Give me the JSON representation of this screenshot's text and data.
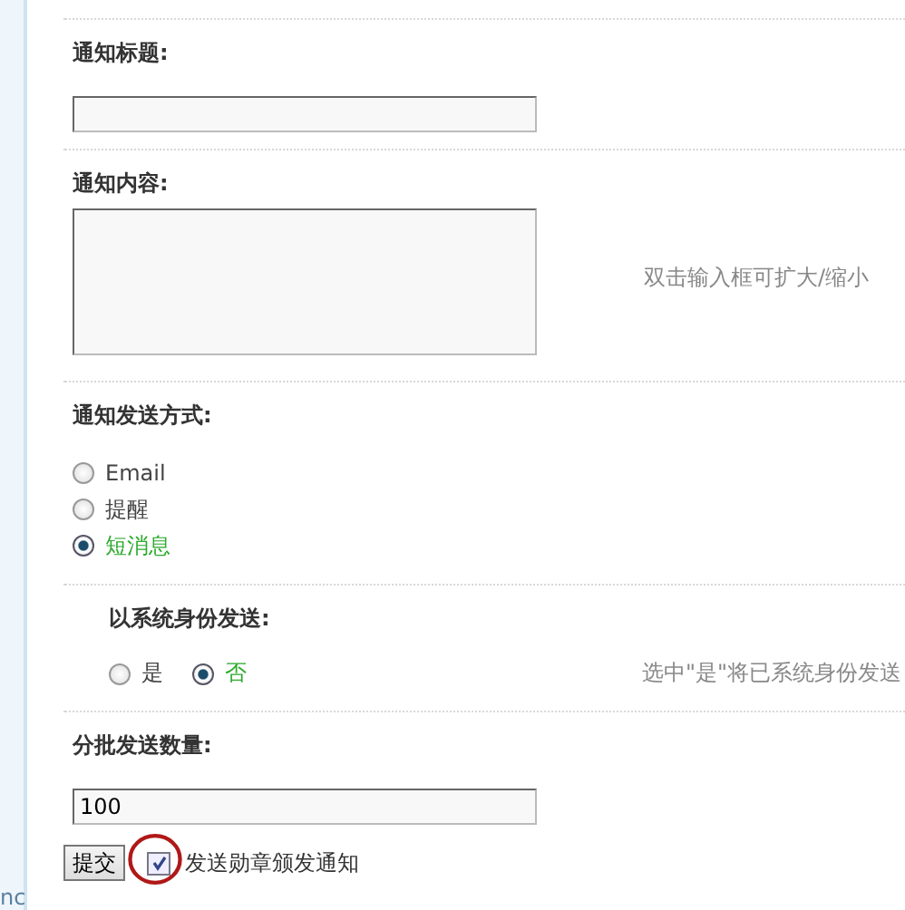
{
  "sidebar": {
    "fragment": "nc"
  },
  "title_field": {
    "label": "通知标题:"
  },
  "content_field": {
    "label": "通知内容:",
    "hint": "双击输入框可扩大/缩小"
  },
  "send_method": {
    "label": "通知发送方式:",
    "options": [
      {
        "label": "Email",
        "selected": false
      },
      {
        "label": "提醒",
        "selected": false
      },
      {
        "label": "短消息",
        "selected": true
      }
    ]
  },
  "send_as_system": {
    "label": "以系统身份发送:",
    "hint": "选中\"是\"将已系统身份发送",
    "options": [
      {
        "label": "是",
        "selected": false
      },
      {
        "label": "否",
        "selected": true
      }
    ]
  },
  "batch_size": {
    "label": "分批发送数量:",
    "value": "100"
  },
  "submit_button": "提交",
  "notify_checkbox": {
    "label": "发送勋章颁发通知",
    "checked": true,
    "circled": true
  }
}
